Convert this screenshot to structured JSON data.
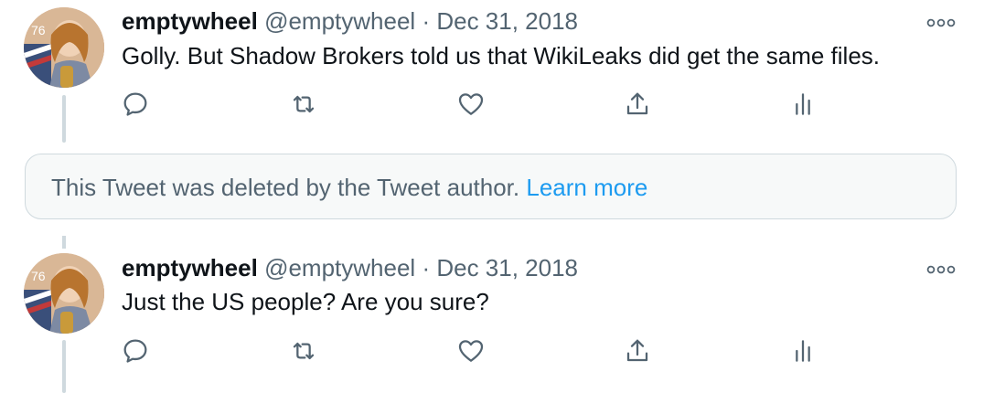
{
  "tweets": [
    {
      "name": "emptywheel",
      "handle": "@emptywheel",
      "separator": "·",
      "date": "Dec 31, 2018",
      "text": "Golly. But Shadow Brokers told us that WikiLeaks did get the same files."
    },
    {
      "name": "emptywheel",
      "handle": "@emptywheel",
      "separator": "·",
      "date": "Dec 31, 2018",
      "text": "Just the US people? Are you sure?"
    }
  ],
  "deleted_notice": {
    "text": "This Tweet was deleted by the Tweet author.",
    "link": "Learn more"
  },
  "icons": {
    "reply": "reply-icon",
    "retweet": "retweet-icon",
    "like": "like-icon",
    "share": "share-icon",
    "analytics": "analytics-icon",
    "more": "more-icon"
  },
  "colors": {
    "primary_text": "#0f1419",
    "secondary_text": "#536471",
    "link": "#1d9bf0",
    "border": "#cfd9de",
    "notice_bg": "#f7f9f9"
  }
}
